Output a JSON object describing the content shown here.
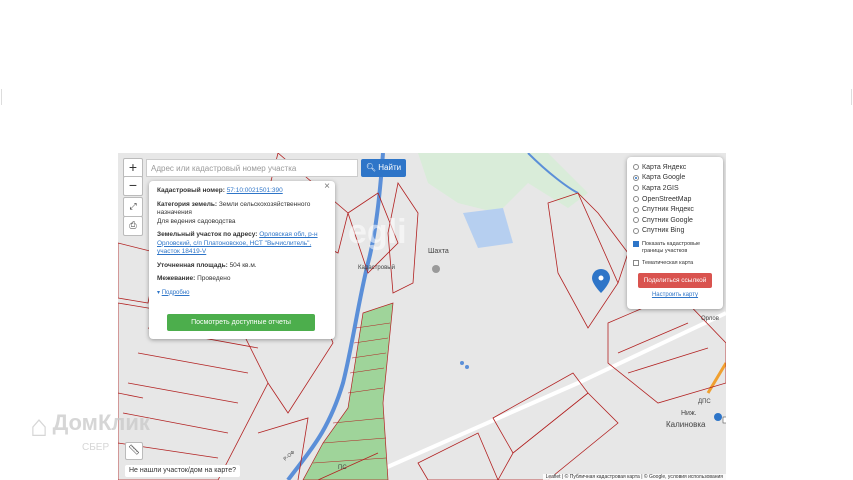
{
  "search": {
    "placeholder": "Адрес или кадастровый номер участка",
    "button_label": "Найти"
  },
  "zoom": {
    "in_label": "+",
    "out_label": "−"
  },
  "info_card": {
    "cadastral_label": "Кадастровый номер:",
    "cadastral_value": "57:10:0021501:390",
    "category_label": "Категория земель:",
    "category_value": "Земли сельскохозяйственного назначения",
    "use_value": "Для ведения садоводства",
    "address_label": "Земельный участок по адресу:",
    "address_value": "Орловская обл, р-н Орловский, с/п Платоновское, НСТ \"Вычислитель\", участок 18419-V",
    "area_label": "Уточненная площадь:",
    "area_value": "504 кв.м.",
    "survey_label": "Межевание:",
    "survey_value": "Проведено",
    "more_label": "Подробно",
    "reports_button": "Посмотреть доступные отчеты",
    "close_label": "×"
  },
  "layers": {
    "options": [
      {
        "label": "Карта Яндекс",
        "selected": false
      },
      {
        "label": "Карта Google",
        "selected": true
      },
      {
        "label": "Карта 2GIS",
        "selected": false
      },
      {
        "label": "OpenStreetMap",
        "selected": false
      },
      {
        "label": "Спутник Яндекс",
        "selected": false
      },
      {
        "label": "Спутник Google",
        "selected": false
      },
      {
        "label": "Спутник Bing",
        "selected": false
      }
    ],
    "show_boundaries_label": "Показать кадастровые границы участков",
    "show_boundaries_checked": true,
    "thematic_label": "Тематическая карта",
    "thematic_checked": false,
    "share_button": "Поделиться ссылкой",
    "setup_link": "Настроить карту"
  },
  "map_labels": {
    "shakhta": "Шахта",
    "nizh": "Ниж.",
    "kalinovka": "Калиновка",
    "ps": "ПС",
    "dps": "ДПС",
    "orlo": "Орлов",
    "road": "Р-ОФ",
    "kadi": "Кадастровый"
  },
  "not_found_label": "Не нашли участок/дом на карте?",
  "attribution": "Leaflet | © Публичная кадастровая карта | © Google, условия использования",
  "watermark": {
    "top": "egli",
    "bottom": "ДомКлик",
    "sub": "СБЕР"
  },
  "colors": {
    "parcel": "#b22222",
    "primary": "#2e75c8",
    "success": "#4cae4c",
    "danger": "#d9534f",
    "river": "#5b8fd8",
    "garden": "#9fd49a"
  }
}
